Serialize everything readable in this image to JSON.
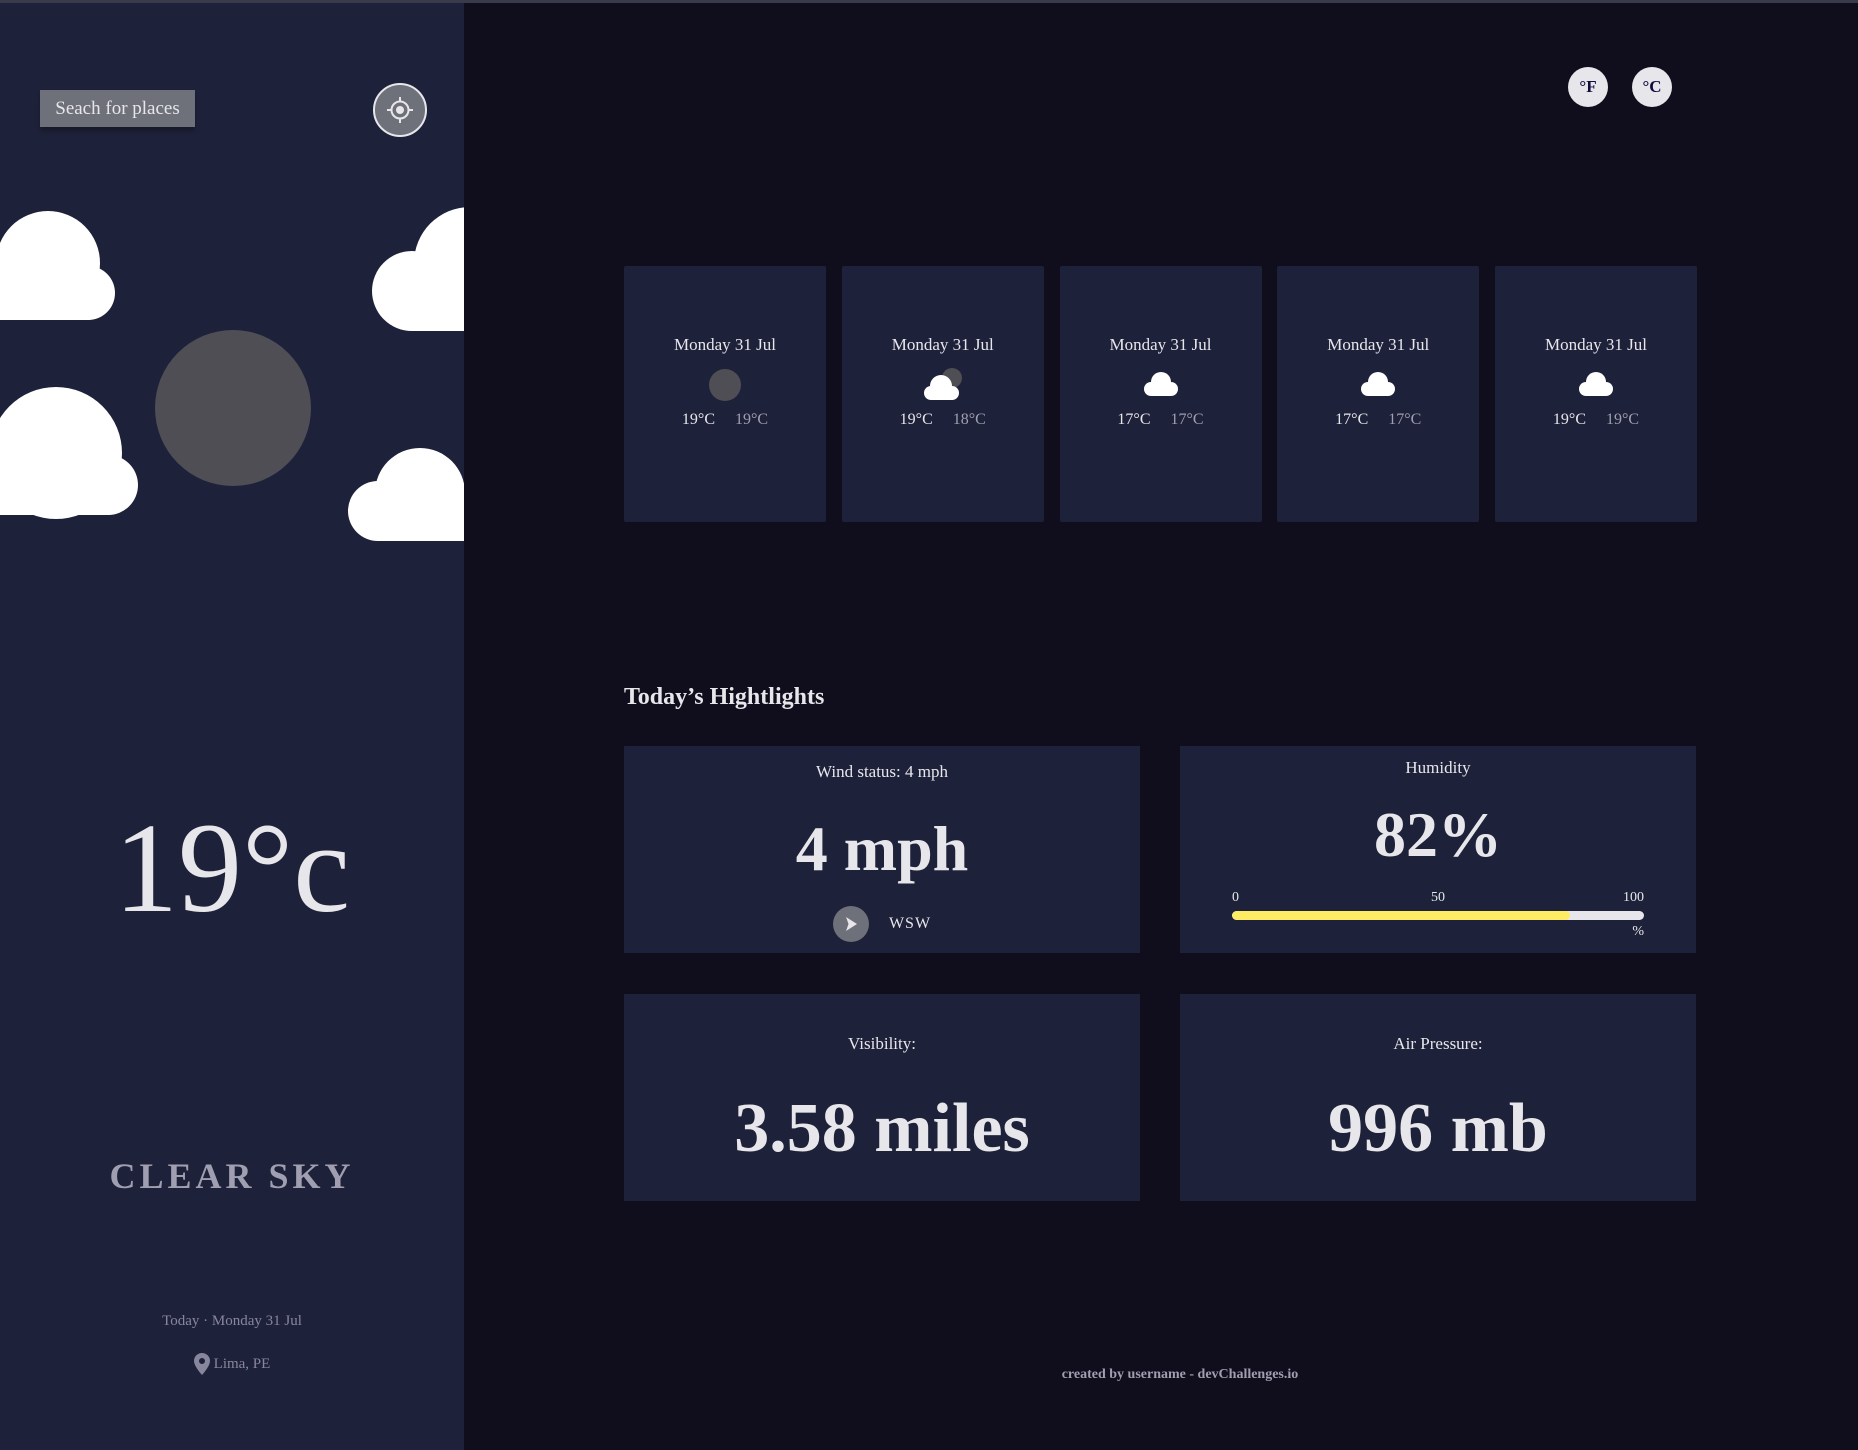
{
  "sidebar": {
    "search_label": "Seach for places",
    "locate_icon": "crosshair-icon",
    "temperature": "19°c",
    "condition": "CLEAR SKY",
    "today_label": "Today · Monday 31 Jul",
    "location": "Lima, PE",
    "location_icon": "map-pin-icon"
  },
  "units": {
    "fahrenheit": "°F",
    "celsius": "°C"
  },
  "forecast": [
    {
      "date": "Monday 31 Jul",
      "icon": "clear-sky-icon",
      "max": "19°C",
      "min": "19°C"
    },
    {
      "date": "Monday 31 Jul",
      "icon": "few-clouds-icon",
      "max": "19°C",
      "min": "18°C"
    },
    {
      "date": "Monday 31 Jul",
      "icon": "cloud-icon",
      "max": "17°C",
      "min": "17°C"
    },
    {
      "date": "Monday 31 Jul",
      "icon": "cloud-icon",
      "max": "17°C",
      "min": "17°C"
    },
    {
      "date": "Monday 31 Jul",
      "icon": "cloud-icon",
      "max": "19°C",
      "min": "19°C"
    }
  ],
  "highlights": {
    "title": "Today’s Hightlights",
    "wind": {
      "label": "Wind status: 4 mph",
      "value": "4 mph",
      "direction": "WSW",
      "icon": "navigation-arrow-icon"
    },
    "humidity": {
      "label": "Humidity",
      "value": "82%",
      "percent": 82,
      "scale_min": "0",
      "scale_mid": "50",
      "scale_max": "100",
      "unit": "%"
    },
    "visibility": {
      "label": "Visibility:",
      "value": "3.58 miles"
    },
    "air_pressure": {
      "label": "Air Pressure:",
      "value": "996 mb"
    }
  },
  "footer": "created by username - devChallenges.io",
  "colors": {
    "background": "#100e1d",
    "panel": "#1e213a",
    "accent_bar": "#ffec65",
    "muted_text": "#a09fb1",
    "button_gray": "#6e707a"
  }
}
